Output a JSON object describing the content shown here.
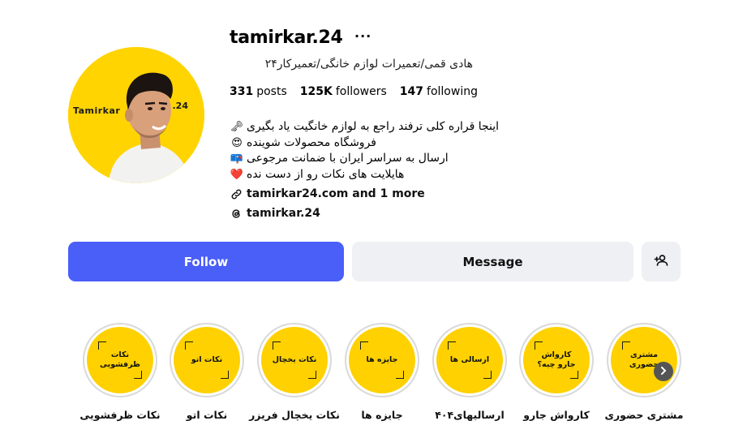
{
  "profile": {
    "username": "tamirkar.24",
    "more_label": "···",
    "full_name": "هادی قمی/تعمیرات لوازم خانگی/تعمیرکار۲۴",
    "avatar": {
      "brand_text": "Tamirkar",
      "brand_num": ".24"
    }
  },
  "stats": [
    {
      "value": "331",
      "label": "posts"
    },
    {
      "value": "125K",
      "label": "followers"
    },
    {
      "value": "147",
      "label": "following"
    }
  ],
  "bio": [
    {
      "icon": "key-icon",
      "emoji": "🗝",
      "text": "اینجا قراره کلی ترفند راجع به لوازم خانگیت یاد بگیری"
    },
    {
      "icon": "heart-eyes-icon",
      "emoji": "😍",
      "text": "فروشگاه محصولات شوینده"
    },
    {
      "icon": "mailbox-icon",
      "emoji": "📪",
      "text": "ارسال به سراسر ایران با ضمانت مرجوعی"
    },
    {
      "icon": "heart-icon",
      "emoji": "❤️",
      "text": "هایلایت های نکات رو از دست نده"
    }
  ],
  "links": {
    "website": "tamirkar24.com and 1 more",
    "threads": "tamirkar.24"
  },
  "actions": {
    "follow": "Follow",
    "message": "Message"
  },
  "highlights": [
    {
      "cover": "نکات ظرفشویی",
      "label": "نکات ظرفشویی"
    },
    {
      "cover": "نکات اتو",
      "label": "نکات اتو"
    },
    {
      "cover": "نکات یخچال",
      "label": "نکات یخچال فریزر"
    },
    {
      "cover": "جایزه ها",
      "label": "جایزه ها"
    },
    {
      "cover": "ارسالی ها",
      "label": "ارسالیهای۴۰۴"
    },
    {
      "cover": "کارواش جارو چیه؟",
      "label": "کارواش جارو"
    },
    {
      "cover": "مشتری حضوری",
      "label": "مشتری حضوری"
    }
  ],
  "colors": {
    "follow_button": "#4a5ef8",
    "highlight_fill": "#ffd100",
    "avatar_bg": "#ffd400"
  }
}
